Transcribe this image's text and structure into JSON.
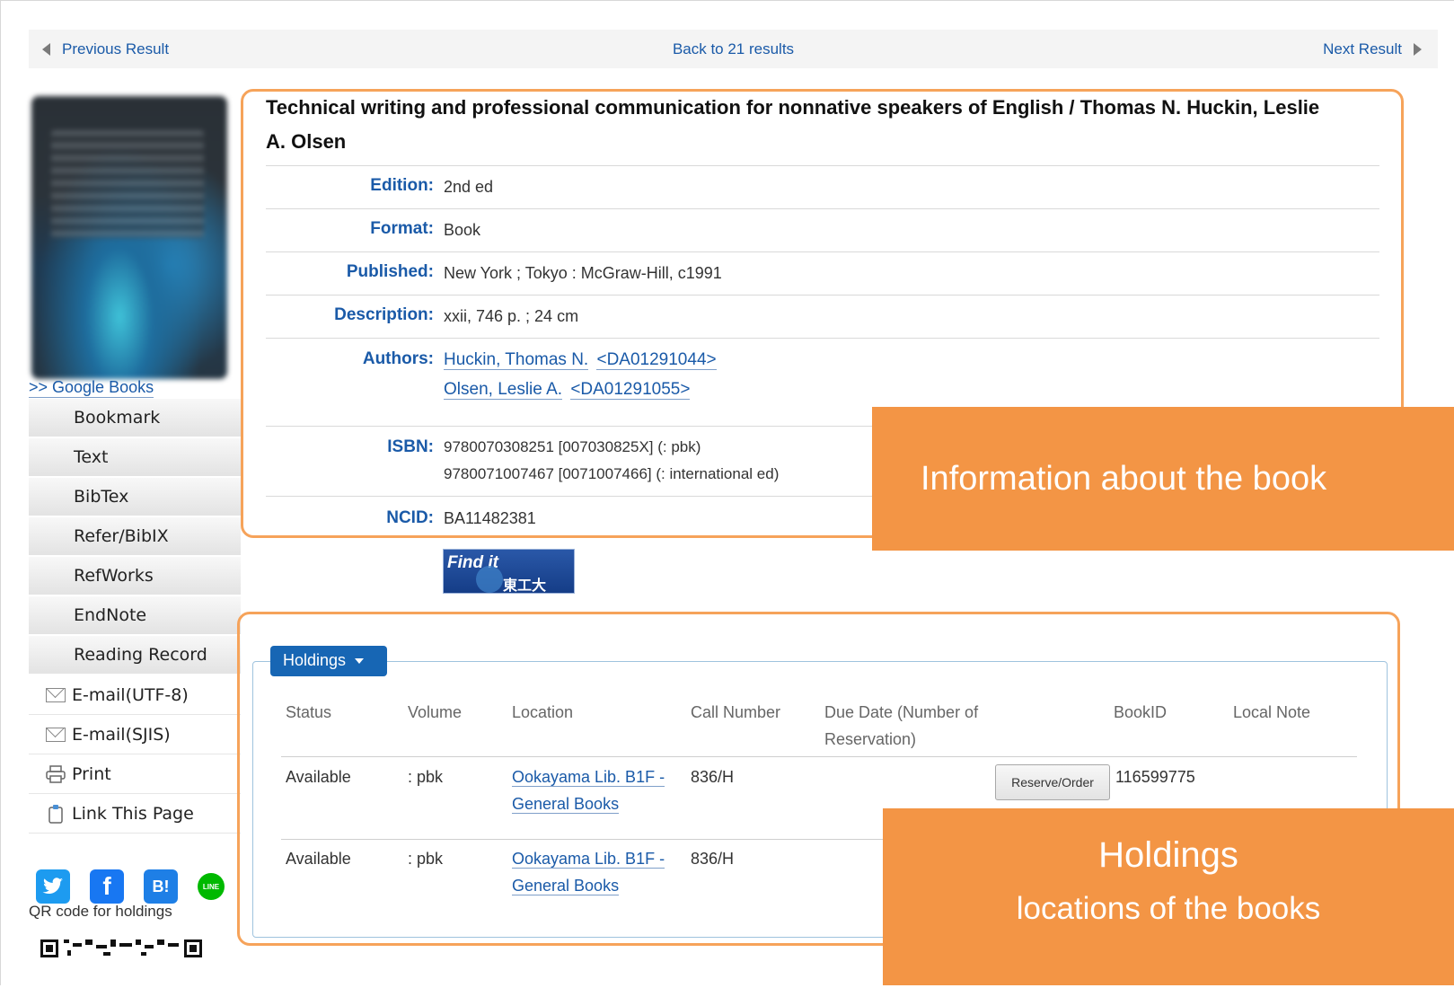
{
  "nav": {
    "previous": "Previous Result",
    "back": "Back to 21 results",
    "next": "Next Result"
  },
  "sidebar": {
    "google_books": ">> Google Books",
    "export_items": [
      "Bookmark",
      "Text",
      "BibTex",
      "Refer/BibIX",
      "RefWorks",
      "EndNote",
      "Reading Record"
    ],
    "email_utf8": "E-mail(UTF-8)",
    "email_sjis": "E-mail(SJIS)",
    "print": "Print",
    "link_page": "Link This Page",
    "social": [
      "twitter-icon",
      "facebook-icon",
      "hatena-bookmark-icon",
      "line-icon"
    ],
    "qr_label": "QR code for holdings"
  },
  "book": {
    "title": "Technical writing and professional communication for nonnative speakers of English / Thomas N. Huckin, Leslie A. Olsen",
    "labels": {
      "edition": "Edition:",
      "format": "Format:",
      "published": "Published:",
      "description": "Description:",
      "authors": "Authors:",
      "isbn": "ISBN:",
      "ncid": "NCID:"
    },
    "edition": "2nd ed",
    "format": "Book",
    "published": "New York ; Tokyo : McGraw-Hill, c1991",
    "description": "xxii, 746 p. ; 24 cm",
    "authors": [
      {
        "name": "Huckin, Thomas N.",
        "id": "<DA01291044>"
      },
      {
        "name": "Olsen, Leslie A.",
        "id": "<DA01291055>"
      }
    ],
    "isbn": [
      "9780070308251 [007030825X] (: pbk)",
      "9780071007467 [0071007466] (: international ed)"
    ],
    "ncid": "BA11482381",
    "findit_text": "Find it",
    "findit_org": "東工大"
  },
  "holdings": {
    "button": "Holdings",
    "columns": [
      "Status",
      "Volume",
      "Location",
      "Call Number",
      "Due Date (Number of Reservation)",
      "BookID",
      "Local Note"
    ],
    "reserve_button": "Reserve/Order",
    "rows": [
      {
        "status": "Available",
        "volume": ": pbk",
        "location": "Ookayama Lib. B1F - General Books",
        "call_number": "836/H",
        "book_id": "116599775"
      },
      {
        "status": "Available",
        "volume": ": pbk",
        "location": "Ookayama Lib. B1F - General Books",
        "call_number": "836/H",
        "book_id": ""
      }
    ]
  },
  "overlays": {
    "info": "Information about the book",
    "holdings_title": "Holdings",
    "holdings_sub": "locations of the books"
  },
  "colors": {
    "link": "#1a5aa8",
    "highlight_border": "#f6a35a",
    "overlay": "#f39545",
    "holdings_button": "#1766b4"
  }
}
